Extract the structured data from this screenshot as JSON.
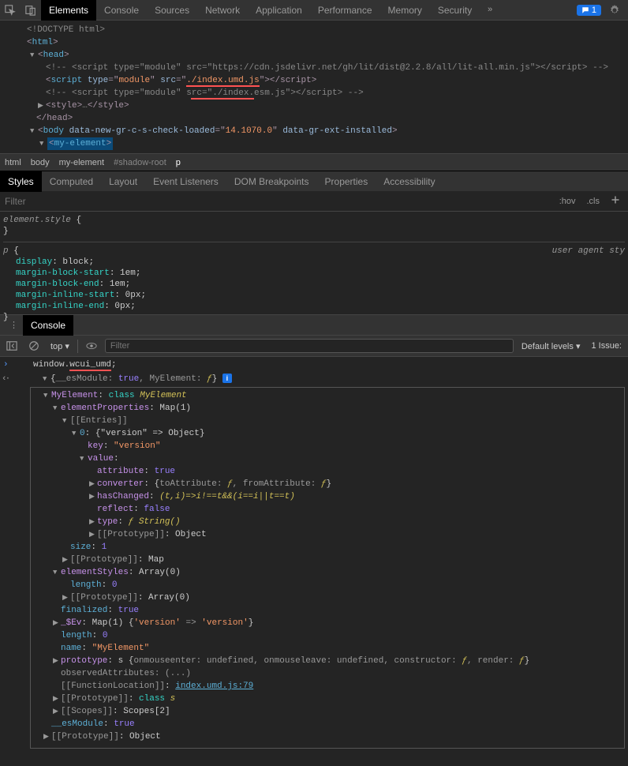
{
  "topbar": {
    "tabs": [
      "Elements",
      "Console",
      "Sources",
      "Network",
      "Application",
      "Performance",
      "Memory",
      "Security"
    ],
    "chat_count": "1"
  },
  "dom": {
    "l1": "<!DOCTYPE html>",
    "l2_tag": "html",
    "l3_tag": "head",
    "l4": "<!-- <script type=\"module\" src=\"https://cdn.jsdelivr.net/gh/lit/dist@2.2.8/all/lit-all.min.js\"></​script> -->",
    "l5_tag": "script",
    "l5_a1": "type",
    "l5_v1": "module",
    "l5_a2": "src",
    "l5_v2": "./index.umd.js",
    "l5_close": "</​script>",
    "l6": "<!-- <script type=\"module\" src=\"./index.esm.js\"></​script> -->",
    "l7_open": "<style>",
    "l7_mid": "…",
    "l7_close": "</style>",
    "l8": "</head>",
    "l9_tag": "body",
    "l9_a1": "data-new-gr-c-s-check-loaded",
    "l9_v1": "14.1070.0",
    "l9_a2": "data-gr-ext-installed",
    "l10": "my-element"
  },
  "breadcrumb": [
    "html",
    "body",
    "my-element",
    "#shadow-root",
    "p"
  ],
  "styles_tabs": [
    "Styles",
    "Computed",
    "Layout",
    "Event Listeners",
    "DOM Breakpoints",
    "Properties",
    "Accessibility"
  ],
  "filter": {
    "placeholder": "Filter",
    "hov": ":hov",
    "cls": ".cls"
  },
  "styles": {
    "element_style": "element.style",
    "p": "p",
    "ua": "user agent sty",
    "display": "display",
    "display_v": "block",
    "mbs": "margin-block-start",
    "mbs_v": "1em",
    "mbe": "margin-block-end",
    "mbe_v": "1em",
    "mis": "margin-inline-start",
    "mis_v": "0px",
    "mie": "margin-inline-end",
    "mie_v": "0px"
  },
  "console_header": {
    "tab": "Console"
  },
  "console_toolbar": {
    "context": "top",
    "filter_placeholder": "Filter",
    "levels": "Default levels",
    "issue": "1 Issue:"
  },
  "console": {
    "input": "window.wcui_umd;",
    "input_pre": "window.",
    "input_hl": "wcui_umd",
    "input_post": ";",
    "result_top": "{__esModule: true, MyElement: ƒ}",
    "r_es": "__esModule",
    "r_true": "true",
    "r_me": "MyElement",
    "r_f": "ƒ",
    "me_key": "MyElement",
    "me_class": "class",
    "me_classname": "MyElement",
    "ep": "elementProperties",
    "ep_v": "Map(1)",
    "entries": "[[Entries]]",
    "entry0": "0",
    "entry0_v": "{\"version\" => Object}",
    "key_l": "key",
    "key_v": "\"version\"",
    "value_l": "value",
    "attribute": "attribute",
    "attr_v": "true",
    "converter": "converter",
    "conv_open": "{",
    "toAttribute": "toAttribute",
    "fromAttribute": "fromAttribute",
    "conv_close": "}",
    "hasChanged": "hasChanged",
    "hc_v": "(t,i)=>i!==t&&(i==i||t==t)",
    "reflect": "reflect",
    "reflect_v": "false",
    "type_l": "type",
    "type_v": "String()",
    "proto": "[[Prototype]]",
    "proto_obj": "Object",
    "size": "size",
    "size_v": "1",
    "proto_map": "Map",
    "es": "elementStyles",
    "es_v": "Array(0)",
    "length": "length",
    "length_v": "0",
    "proto_arr": "Array(0)",
    "finalized": "finalized",
    "fin_v": "true",
    "sev": "_$Ev",
    "sev_v": "Map(1)",
    "sev_open": "{",
    "sev_k": "'version'",
    "sev_arrow": "=>",
    "sev_val": "'version'",
    "sev_close": "}",
    "len2": "length",
    "len2_v": "0",
    "name_l": "name",
    "name_v": "\"MyElement\"",
    "prototype": "prototype",
    "proto_s": "s",
    "onme": "onmouseenter",
    "undef": "undefined",
    "onml": "onmouseleave",
    "ctor": "constructor",
    "render": "render",
    "obsAttr": "observedAttributes",
    "obsAttr_v": "(...)",
    "fnloc": "[[FunctionLocation]]",
    "fnloc_v": "index.umd.js:79",
    "proto_class_s": "class s",
    "scopes": "[[Scopes]]",
    "scopes_v": "Scopes[2]",
    "es2": "__esModule",
    "es2_v": "true",
    "proto_obj2": "Object"
  }
}
